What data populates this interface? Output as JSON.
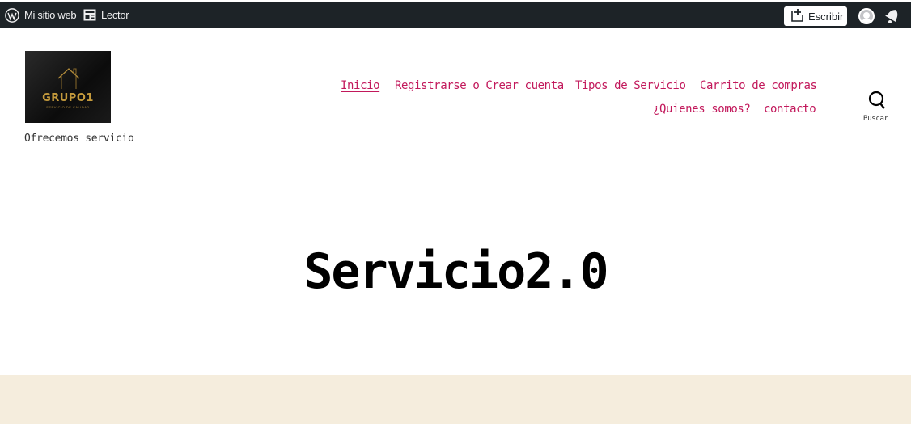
{
  "adminbar": {
    "my_site": "Mi sitio web",
    "reader": "Lector",
    "write": "Escribir"
  },
  "site": {
    "logo_text": "GRUPO1",
    "logo_subtext": "SERVICIO DE CALIDAD",
    "tagline": "Ofrecemos servicio"
  },
  "nav": {
    "items": [
      "Inicio",
      "Registrarse o Crear cuenta",
      "Tipos de Servicio",
      "Carrito de compras",
      "¿Quienes somos?",
      "contacto"
    ]
  },
  "search": {
    "label": "Buscar"
  },
  "page": {
    "title": "Servicio2.0"
  },
  "colors": {
    "adminbar": "#1d2327",
    "link": "#c2185b",
    "band": "#f5eddd"
  }
}
